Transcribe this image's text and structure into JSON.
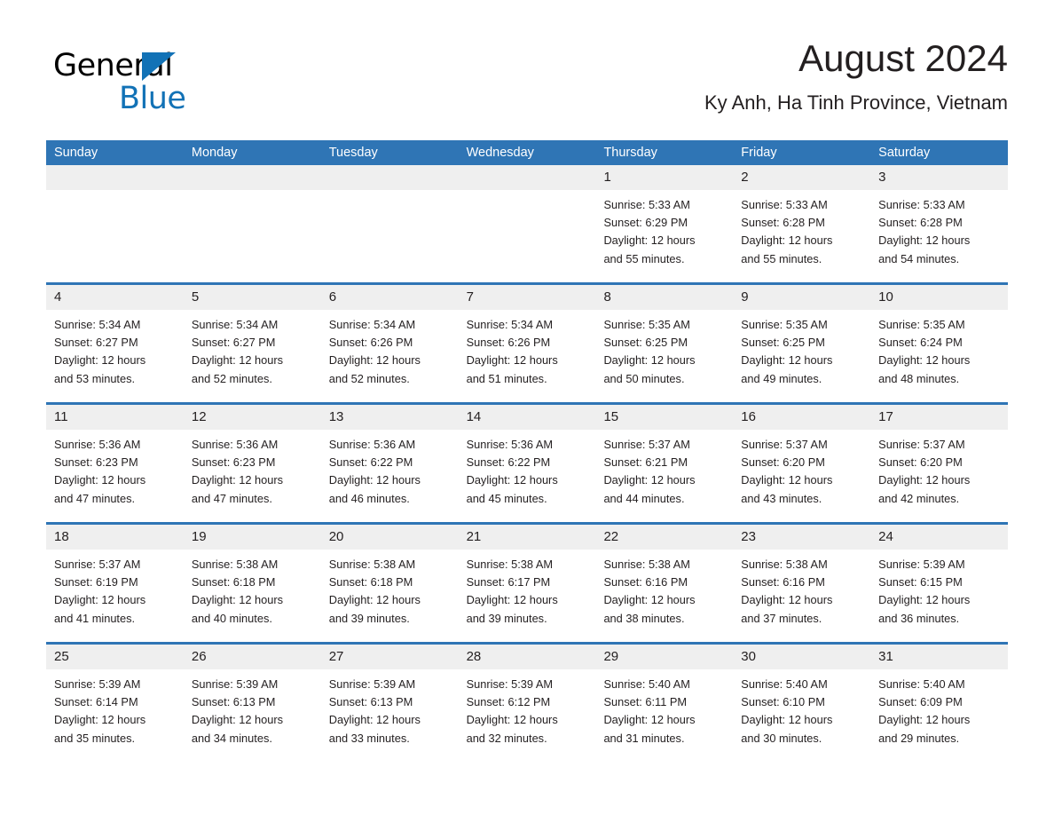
{
  "brand": {
    "name_part1": "General",
    "name_part2": "Blue",
    "accent_color": "#1272b6"
  },
  "header": {
    "title": "August 2024",
    "subtitle": "Ky Anh, Ha Tinh Province, Vietnam",
    "header_bg_color": "#2f75b5",
    "day_band_color": "#efefef"
  },
  "weekdays": [
    "Sunday",
    "Monday",
    "Tuesday",
    "Wednesday",
    "Thursday",
    "Friday",
    "Saturday"
  ],
  "weeks": [
    [
      {
        "date": "",
        "sunrise": "",
        "sunset": "",
        "daylight_line1": "",
        "daylight_line2": ""
      },
      {
        "date": "",
        "sunrise": "",
        "sunset": "",
        "daylight_line1": "",
        "daylight_line2": ""
      },
      {
        "date": "",
        "sunrise": "",
        "sunset": "",
        "daylight_line1": "",
        "daylight_line2": ""
      },
      {
        "date": "",
        "sunrise": "",
        "sunset": "",
        "daylight_line1": "",
        "daylight_line2": ""
      },
      {
        "date": "1",
        "sunrise": "Sunrise: 5:33 AM",
        "sunset": "Sunset: 6:29 PM",
        "daylight_line1": "Daylight: 12 hours",
        "daylight_line2": "and 55 minutes."
      },
      {
        "date": "2",
        "sunrise": "Sunrise: 5:33 AM",
        "sunset": "Sunset: 6:28 PM",
        "daylight_line1": "Daylight: 12 hours",
        "daylight_line2": "and 55 minutes."
      },
      {
        "date": "3",
        "sunrise": "Sunrise: 5:33 AM",
        "sunset": "Sunset: 6:28 PM",
        "daylight_line1": "Daylight: 12 hours",
        "daylight_line2": "and 54 minutes."
      }
    ],
    [
      {
        "date": "4",
        "sunrise": "Sunrise: 5:34 AM",
        "sunset": "Sunset: 6:27 PM",
        "daylight_line1": "Daylight: 12 hours",
        "daylight_line2": "and 53 minutes."
      },
      {
        "date": "5",
        "sunrise": "Sunrise: 5:34 AM",
        "sunset": "Sunset: 6:27 PM",
        "daylight_line1": "Daylight: 12 hours",
        "daylight_line2": "and 52 minutes."
      },
      {
        "date": "6",
        "sunrise": "Sunrise: 5:34 AM",
        "sunset": "Sunset: 6:26 PM",
        "daylight_line1": "Daylight: 12 hours",
        "daylight_line2": "and 52 minutes."
      },
      {
        "date": "7",
        "sunrise": "Sunrise: 5:34 AM",
        "sunset": "Sunset: 6:26 PM",
        "daylight_line1": "Daylight: 12 hours",
        "daylight_line2": "and 51 minutes."
      },
      {
        "date": "8",
        "sunrise": "Sunrise: 5:35 AM",
        "sunset": "Sunset: 6:25 PM",
        "daylight_line1": "Daylight: 12 hours",
        "daylight_line2": "and 50 minutes."
      },
      {
        "date": "9",
        "sunrise": "Sunrise: 5:35 AM",
        "sunset": "Sunset: 6:25 PM",
        "daylight_line1": "Daylight: 12 hours",
        "daylight_line2": "and 49 minutes."
      },
      {
        "date": "10",
        "sunrise": "Sunrise: 5:35 AM",
        "sunset": "Sunset: 6:24 PM",
        "daylight_line1": "Daylight: 12 hours",
        "daylight_line2": "and 48 minutes."
      }
    ],
    [
      {
        "date": "11",
        "sunrise": "Sunrise: 5:36 AM",
        "sunset": "Sunset: 6:23 PM",
        "daylight_line1": "Daylight: 12 hours",
        "daylight_line2": "and 47 minutes."
      },
      {
        "date": "12",
        "sunrise": "Sunrise: 5:36 AM",
        "sunset": "Sunset: 6:23 PM",
        "daylight_line1": "Daylight: 12 hours",
        "daylight_line2": "and 47 minutes."
      },
      {
        "date": "13",
        "sunrise": "Sunrise: 5:36 AM",
        "sunset": "Sunset: 6:22 PM",
        "daylight_line1": "Daylight: 12 hours",
        "daylight_line2": "and 46 minutes."
      },
      {
        "date": "14",
        "sunrise": "Sunrise: 5:36 AM",
        "sunset": "Sunset: 6:22 PM",
        "daylight_line1": "Daylight: 12 hours",
        "daylight_line2": "and 45 minutes."
      },
      {
        "date": "15",
        "sunrise": "Sunrise: 5:37 AM",
        "sunset": "Sunset: 6:21 PM",
        "daylight_line1": "Daylight: 12 hours",
        "daylight_line2": "and 44 minutes."
      },
      {
        "date": "16",
        "sunrise": "Sunrise: 5:37 AM",
        "sunset": "Sunset: 6:20 PM",
        "daylight_line1": "Daylight: 12 hours",
        "daylight_line2": "and 43 minutes."
      },
      {
        "date": "17",
        "sunrise": "Sunrise: 5:37 AM",
        "sunset": "Sunset: 6:20 PM",
        "daylight_line1": "Daylight: 12 hours",
        "daylight_line2": "and 42 minutes."
      }
    ],
    [
      {
        "date": "18",
        "sunrise": "Sunrise: 5:37 AM",
        "sunset": "Sunset: 6:19 PM",
        "daylight_line1": "Daylight: 12 hours",
        "daylight_line2": "and 41 minutes."
      },
      {
        "date": "19",
        "sunrise": "Sunrise: 5:38 AM",
        "sunset": "Sunset: 6:18 PM",
        "daylight_line1": "Daylight: 12 hours",
        "daylight_line2": "and 40 minutes."
      },
      {
        "date": "20",
        "sunrise": "Sunrise: 5:38 AM",
        "sunset": "Sunset: 6:18 PM",
        "daylight_line1": "Daylight: 12 hours",
        "daylight_line2": "and 39 minutes."
      },
      {
        "date": "21",
        "sunrise": "Sunrise: 5:38 AM",
        "sunset": "Sunset: 6:17 PM",
        "daylight_line1": "Daylight: 12 hours",
        "daylight_line2": "and 39 minutes."
      },
      {
        "date": "22",
        "sunrise": "Sunrise: 5:38 AM",
        "sunset": "Sunset: 6:16 PM",
        "daylight_line1": "Daylight: 12 hours",
        "daylight_line2": "and 38 minutes."
      },
      {
        "date": "23",
        "sunrise": "Sunrise: 5:38 AM",
        "sunset": "Sunset: 6:16 PM",
        "daylight_line1": "Daylight: 12 hours",
        "daylight_line2": "and 37 minutes."
      },
      {
        "date": "24",
        "sunrise": "Sunrise: 5:39 AM",
        "sunset": "Sunset: 6:15 PM",
        "daylight_line1": "Daylight: 12 hours",
        "daylight_line2": "and 36 minutes."
      }
    ],
    [
      {
        "date": "25",
        "sunrise": "Sunrise: 5:39 AM",
        "sunset": "Sunset: 6:14 PM",
        "daylight_line1": "Daylight: 12 hours",
        "daylight_line2": "and 35 minutes."
      },
      {
        "date": "26",
        "sunrise": "Sunrise: 5:39 AM",
        "sunset": "Sunset: 6:13 PM",
        "daylight_line1": "Daylight: 12 hours",
        "daylight_line2": "and 34 minutes."
      },
      {
        "date": "27",
        "sunrise": "Sunrise: 5:39 AM",
        "sunset": "Sunset: 6:13 PM",
        "daylight_line1": "Daylight: 12 hours",
        "daylight_line2": "and 33 minutes."
      },
      {
        "date": "28",
        "sunrise": "Sunrise: 5:39 AM",
        "sunset": "Sunset: 6:12 PM",
        "daylight_line1": "Daylight: 12 hours",
        "daylight_line2": "and 32 minutes."
      },
      {
        "date": "29",
        "sunrise": "Sunrise: 5:40 AM",
        "sunset": "Sunset: 6:11 PM",
        "daylight_line1": "Daylight: 12 hours",
        "daylight_line2": "and 31 minutes."
      },
      {
        "date": "30",
        "sunrise": "Sunrise: 5:40 AM",
        "sunset": "Sunset: 6:10 PM",
        "daylight_line1": "Daylight: 12 hours",
        "daylight_line2": "and 30 minutes."
      },
      {
        "date": "31",
        "sunrise": "Sunrise: 5:40 AM",
        "sunset": "Sunset: 6:09 PM",
        "daylight_line1": "Daylight: 12 hours",
        "daylight_line2": "and 29 minutes."
      }
    ]
  ]
}
